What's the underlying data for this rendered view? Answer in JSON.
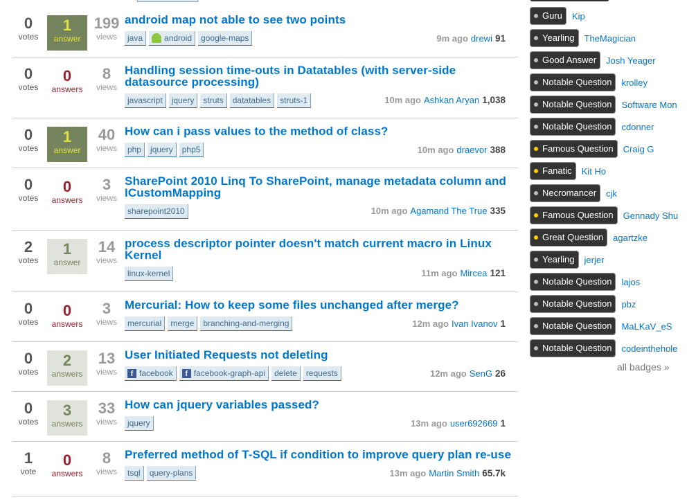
{
  "questions": [
    {
      "votes": "0",
      "votes_label": "votes",
      "answers": "1",
      "answers_label": "answer",
      "answer_state": "accepted",
      "views": "199",
      "views_label": "views",
      "title": "android map not able to see two points",
      "tags": [
        {
          "t": "java"
        },
        {
          "t": "android",
          "icon": "android"
        },
        {
          "t": "google-maps"
        }
      ],
      "ago": "9m ago",
      "user": "drewi",
      "rep": "91"
    },
    {
      "votes": "0",
      "votes_label": "votes",
      "answers": "0",
      "answers_label": "answers",
      "answer_state": "zero",
      "views": "8",
      "views_label": "views",
      "title": "Handling session time-outs in Datatables (with server-side datasource processing)",
      "tags": [
        {
          "t": "javascript"
        },
        {
          "t": "jquery"
        },
        {
          "t": "struts"
        },
        {
          "t": "datatables"
        },
        {
          "t": "struts-1"
        }
      ],
      "ago": "10m ago",
      "user": "Ashkan Aryan",
      "rep": "1,038"
    },
    {
      "votes": "0",
      "votes_label": "votes",
      "answers": "1",
      "answers_label": "answer",
      "answer_state": "accepted",
      "views": "40",
      "views_label": "views",
      "title": "How can i pass values to the method of class?",
      "tags": [
        {
          "t": "php"
        },
        {
          "t": "jquery"
        },
        {
          "t": "php5"
        }
      ],
      "ago": "10m ago",
      "user": "draevor",
      "rep": "388"
    },
    {
      "votes": "0",
      "votes_label": "votes",
      "answers": "0",
      "answers_label": "answers",
      "answer_state": "zero",
      "views": "3",
      "views_label": "views",
      "title": "SharePoint 2010 Linq To SharePoint, manage metadata column and ICustomMapping",
      "tags": [
        {
          "t": "sharepoint2010"
        }
      ],
      "ago": "10m ago",
      "user": "Agamand The True",
      "rep": "335"
    },
    {
      "votes": "2",
      "votes_label": "votes",
      "answers": "1",
      "answers_label": "answer",
      "answer_state": "some",
      "views": "14",
      "views_label": "views",
      "title": "process descriptor pointer doesn't match current macro in Linux Kernel",
      "tags": [
        {
          "t": "linux-kernel"
        }
      ],
      "ago": "11m ago",
      "user": "Mircea",
      "rep": "121"
    },
    {
      "votes": "0",
      "votes_label": "votes",
      "answers": "0",
      "answers_label": "answers",
      "answer_state": "zero",
      "views": "3",
      "views_label": "views",
      "title": "Mercurial: How to keep some files unchanged after merge?",
      "tags": [
        {
          "t": "mercurial"
        },
        {
          "t": "merge"
        },
        {
          "t": "branching-and-merging"
        }
      ],
      "ago": "12m ago",
      "user": "Ivan Ivanov",
      "rep": "1"
    },
    {
      "votes": "0",
      "votes_label": "votes",
      "answers": "2",
      "answers_label": "answers",
      "answer_state": "some",
      "views": "13",
      "views_label": "views",
      "title": "User Initiated Requests not deleting",
      "tags": [
        {
          "t": "facebook",
          "icon": "facebook"
        },
        {
          "t": "facebook-graph-api",
          "icon": "facebook"
        },
        {
          "t": "delete"
        },
        {
          "t": "requests"
        }
      ],
      "ago": "12m ago",
      "user": "SenG",
      "rep": "26"
    },
    {
      "votes": "0",
      "votes_label": "votes",
      "answers": "3",
      "answers_label": "answers",
      "answer_state": "some",
      "views": "33",
      "views_label": "views",
      "title": "How can jquery variables passed?",
      "tags": [
        {
          "t": "jquery"
        }
      ],
      "ago": "13m ago",
      "user": "user692669",
      "rep": "1"
    },
    {
      "votes": "1",
      "votes_label": "vote",
      "answers": "0",
      "answers_label": "answers",
      "answer_state": "zero",
      "views": "8",
      "views_label": "views",
      "title": "Preferred method of T-SQL if condition to improve query plan re-use",
      "tags": [
        {
          "t": "tsql"
        },
        {
          "t": "query-plans"
        }
      ],
      "ago": "13m ago",
      "user": "Martin Smith",
      "rep": "65.7k"
    }
  ],
  "badges": [
    {
      "badge": "Guru",
      "user": "Kip",
      "tier": "silver"
    },
    {
      "badge": "Yearling",
      "user": "TheMagician",
      "tier": "silver"
    },
    {
      "badge": "Good Answer",
      "user": "Josh Yeager",
      "tier": "silver"
    },
    {
      "badge": "Notable Question",
      "user": "krolley",
      "tier": "silver"
    },
    {
      "badge": "Notable Question",
      "user": "Software Mon",
      "tier": "silver"
    },
    {
      "badge": "Notable Question",
      "user": "cdonner",
      "tier": "silver"
    },
    {
      "badge": "Famous Question",
      "user": "Craig G",
      "tier": "gold"
    },
    {
      "badge": "Fanatic",
      "user": "Kit Ho",
      "tier": "gold"
    },
    {
      "badge": "Necromancer",
      "user": "cjk",
      "tier": "silver"
    },
    {
      "badge": "Famous Question",
      "user": "Gennady Shu",
      "tier": "gold"
    },
    {
      "badge": "Great Question",
      "user": "agartzke",
      "tier": "gold"
    },
    {
      "badge": "Yearling",
      "user": "jerjer",
      "tier": "silver"
    },
    {
      "badge": "Notable Question",
      "user": "lajos",
      "tier": "silver"
    },
    {
      "badge": "Notable Question",
      "user": "pbz",
      "tier": "silver"
    },
    {
      "badge": "Notable Question",
      "user": "MaLKaV_eS",
      "tier": "silver"
    },
    {
      "badge": "Notable Question",
      "user": "codeinthehole",
      "tier": "silver"
    }
  ],
  "all_badges_link": "all badges »",
  "colors": {
    "gold": "#ffcc00",
    "silver": "#c0c0c0",
    "link": "#0077cc"
  }
}
